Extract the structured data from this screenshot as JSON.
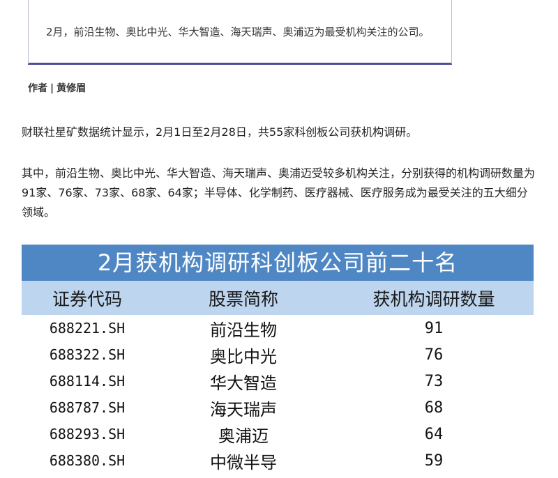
{
  "summary": "2月，前沿生物、奥比中光、华大智造、海天瑞声、奥浦迈为最受机构关注的公司。",
  "author": {
    "label": "作者",
    "separator": "|",
    "name": "黄修眉"
  },
  "paragraphs": [
    "财联社星矿数据统计显示，2月1日至2月28日，共55家科创板公司获机构调研。",
    "其中，前沿生物、奥比中光、华大智造、海天瑞声、奥浦迈受较多机构关注，分别获得的机构调研数量为91家、76家、73家、68家、64家；半导体、化学制药、医疗器械、医疗服务成为最受关注的五大细分领域。"
  ],
  "table": {
    "title": "2月获机构调研科创板公司前二十名",
    "headers": [
      "证券代码",
      "股票简称",
      "获机构调研数量"
    ],
    "rows": [
      [
        "688221.SH",
        "前沿生物",
        "91"
      ],
      [
        "688322.SH",
        "奥比中光",
        "76"
      ],
      [
        "688114.SH",
        "华大智造",
        "73"
      ],
      [
        "688787.SH",
        "海天瑞声",
        "68"
      ],
      [
        "688293.SH",
        "奥浦迈",
        "64"
      ],
      [
        "688380.SH",
        "中微半导",
        "59"
      ]
    ]
  },
  "colors": {
    "title_bg": "#4f87c5",
    "header_bg": "#bdd5ee",
    "box_accent": "#4a4f9c"
  }
}
